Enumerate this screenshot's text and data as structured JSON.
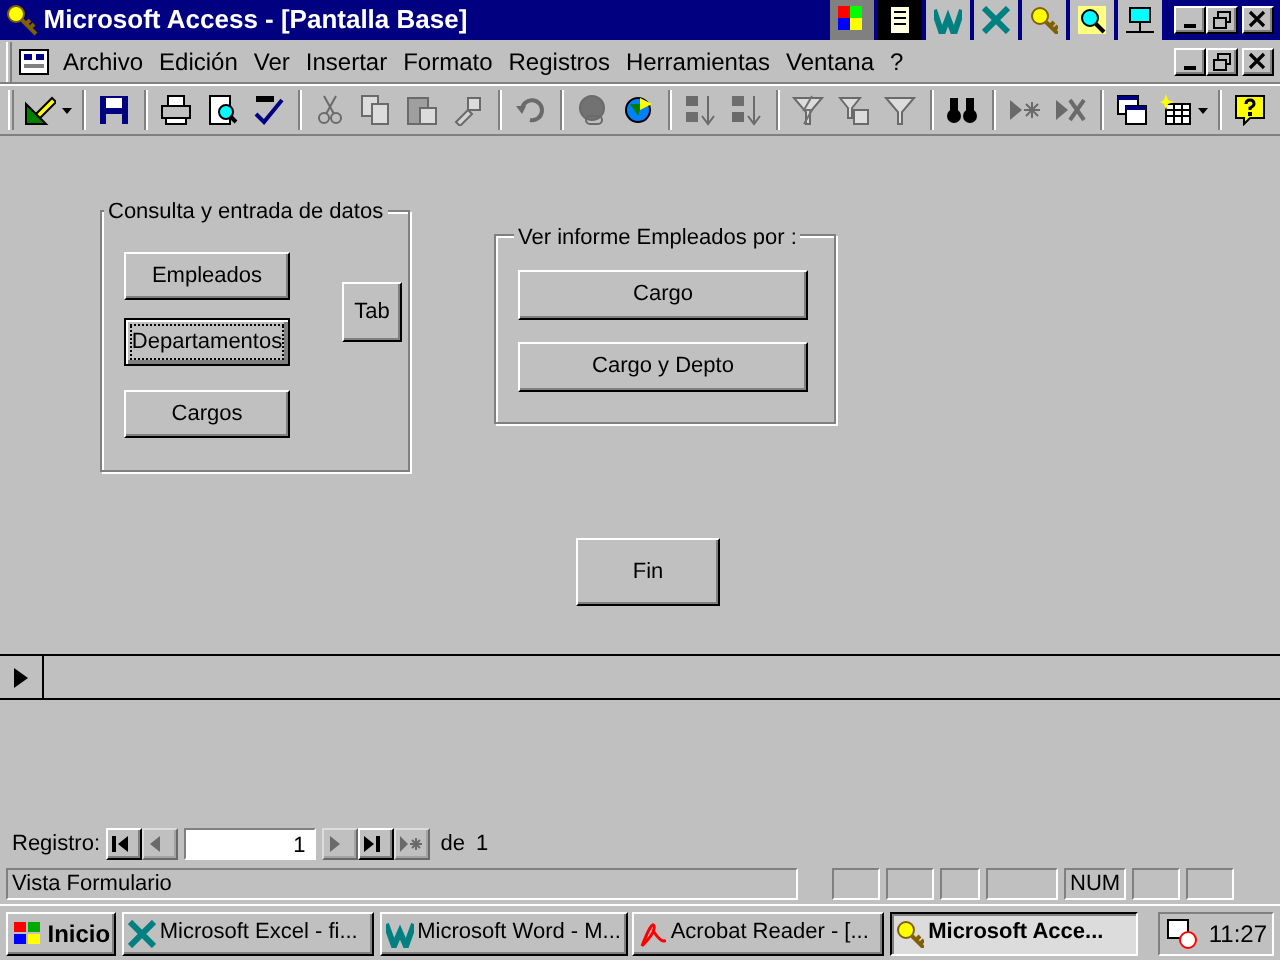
{
  "window": {
    "title": "Microsoft Access - [Pantalla Base]"
  },
  "menu": {
    "items": [
      "Archivo",
      "Edición",
      "Ver",
      "Insertar",
      "Formato",
      "Registros",
      "Herramientas",
      "Ventana",
      "?"
    ]
  },
  "toolbar": {
    "groups": [
      [
        {
          "kind": "view",
          "disabled": false
        }
      ],
      [
        {
          "kind": "save",
          "disabled": false
        }
      ],
      [
        {
          "kind": "print",
          "disabled": false
        },
        {
          "kind": "preview",
          "disabled": false
        },
        {
          "kind": "spelling",
          "disabled": false
        }
      ],
      [
        {
          "kind": "cut",
          "disabled": true
        },
        {
          "kind": "copy",
          "disabled": true
        },
        {
          "kind": "paste",
          "disabled": true
        },
        {
          "kind": "painter",
          "disabled": true
        }
      ],
      [
        {
          "kind": "undo",
          "disabled": true
        }
      ],
      [
        {
          "kind": "hyperlink",
          "disabled": true
        },
        {
          "kind": "web",
          "disabled": false
        }
      ],
      [
        {
          "kind": "sort-asc",
          "disabled": true
        },
        {
          "kind": "sort-desc",
          "disabled": true
        }
      ],
      [
        {
          "kind": "filter-selection",
          "disabled": true
        },
        {
          "kind": "filter-form",
          "disabled": true
        },
        {
          "kind": "filter-apply",
          "disabled": true
        }
      ],
      [
        {
          "kind": "find",
          "disabled": false
        }
      ],
      [
        {
          "kind": "new-record",
          "disabled": true
        },
        {
          "kind": "delete-record",
          "disabled": true
        }
      ],
      [
        {
          "kind": "database",
          "disabled": false
        },
        {
          "kind": "new-object",
          "disabled": false
        }
      ],
      [
        {
          "kind": "help",
          "disabled": false
        }
      ]
    ]
  },
  "form": {
    "frames": [
      {
        "label": "Consulta y entrada de datos",
        "buttons": [
          {
            "label": "Empleados",
            "focused": false
          },
          {
            "label": "Departamentos",
            "focused": true
          },
          {
            "label": "Cargos",
            "focused": false
          }
        ],
        "side_button": {
          "label": "Tab"
        }
      },
      {
        "label": "Ver informe Empleados por :",
        "buttons": [
          {
            "label": "Cargo",
            "focused": false
          },
          {
            "label": "Cargo y Depto",
            "focused": false
          }
        ]
      }
    ],
    "exit_button": {
      "label": "Fin"
    }
  },
  "navigation": {
    "label": "Registro:",
    "record": "1",
    "of_label": "de",
    "total": "1",
    "buttons": [
      {
        "kind": "first",
        "disabled": false
      },
      {
        "kind": "prev",
        "disabled": true
      },
      {
        "kind": "next",
        "disabled": true
      },
      {
        "kind": "last",
        "disabled": false
      },
      {
        "kind": "new",
        "disabled": true
      }
    ]
  },
  "status_bar": {
    "text": "Vista Formulario",
    "indicators": [
      "NUM"
    ]
  },
  "taskbar": {
    "start": "Inicio",
    "tasks": [
      {
        "kind": "excel",
        "label": "Microsoft Excel - fi...",
        "selected": false
      },
      {
        "kind": "word",
        "label": "Microsoft Word - M...",
        "selected": false
      },
      {
        "kind": "acrobat",
        "label": "Acrobat Reader - [...",
        "selected": false
      },
      {
        "kind": "access",
        "label": "Microsoft Acce...",
        "selected": true
      }
    ],
    "time": "11:27"
  }
}
